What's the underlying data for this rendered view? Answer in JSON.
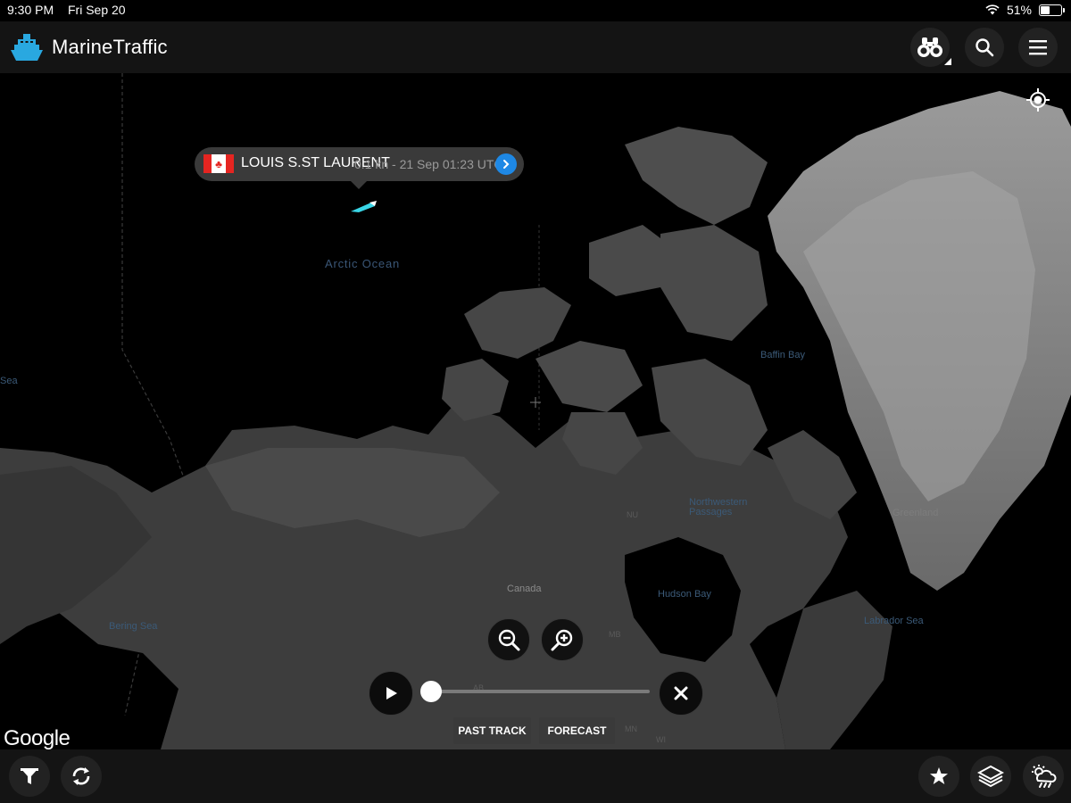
{
  "status_bar": {
    "time": "9:30 PM",
    "date": "Fri Sep 20",
    "battery": "51%",
    "battery_level": 0.51
  },
  "header": {
    "app_title": "MarineTraffic",
    "icons": [
      "marinetraffic-logo-icon",
      "binoculars-icon",
      "search-icon",
      "menu-icon"
    ]
  },
  "map": {
    "labels": {
      "arctic_ocean": "Arctic Ocean",
      "baffin_bay": "Baffin Bay",
      "sea": "Sea",
      "northwestern_passages": "Northwestern\nPassages",
      "greenland": "Greenland",
      "canada": "Canada",
      "hudson_bay": "Hudson Bay",
      "bering_sea": "Bering Sea",
      "labrador_sea": "Labrador Sea",
      "nu": "NU",
      "mb": "MB",
      "mn": "MN",
      "wi": "WI",
      "ab": "AB"
    },
    "attribution": "Google"
  },
  "vessel": {
    "flag": "Canada",
    "name": "LOUIS S.ST LAURENT",
    "info": "0.1 kn - 21 Sep 01:23 UTC",
    "marker_color": "#39d5e6"
  },
  "controls": {
    "zoom_out_icon": "zoom-out-icon",
    "zoom_in_icon": "zoom-in-icon",
    "play_icon": "play-icon",
    "close_icon": "close-icon",
    "timeline_position": 0.0,
    "past_track_label": "PAST TRACK",
    "forecast_label": "FORECAST"
  },
  "bottom_bar": {
    "icons": [
      "filter-icon",
      "refresh-icon",
      "star-icon",
      "layers-icon",
      "weather-icon"
    ]
  },
  "colors": {
    "background": "#000000",
    "bar": "#141414",
    "accent": "#1e88e5",
    "logo": "#29a8e0"
  }
}
